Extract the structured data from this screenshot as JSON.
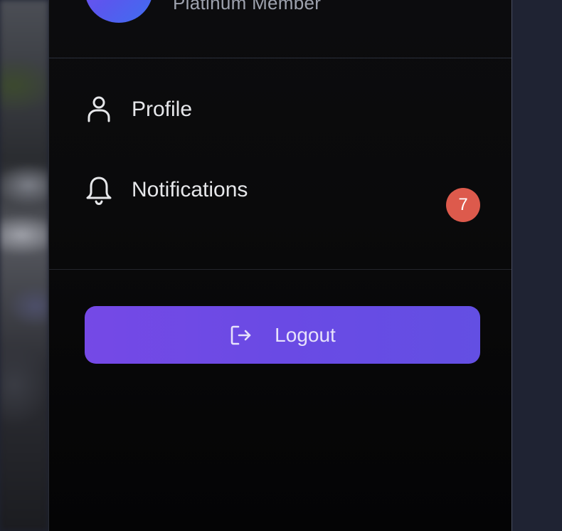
{
  "user": {
    "membership": "Platinum Member"
  },
  "menu": {
    "items": [
      {
        "label": "Profile",
        "icon": "user-icon"
      },
      {
        "label": "Notifications",
        "icon": "bell-icon",
        "badge": "7"
      }
    ]
  },
  "logout": {
    "label": "Logout",
    "icon": "logout-icon"
  },
  "colors": {
    "accent": "#6a4ae4",
    "badge": "#dd5a4c",
    "panel": "#0a0a0b"
  }
}
